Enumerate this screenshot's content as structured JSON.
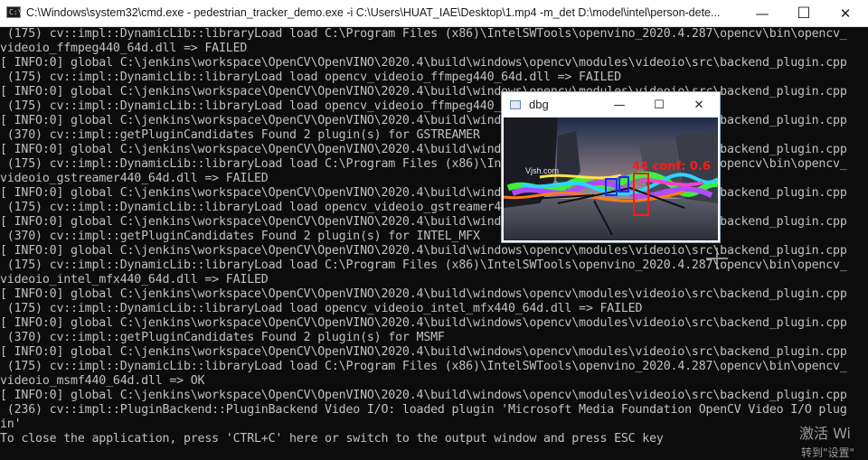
{
  "window": {
    "title": "C:\\Windows\\system32\\cmd.exe - pedestrian_tracker_demo.exe  -i C:\\Users\\HUAT_IAE\\Desktop\\1.mp4 -m_det D:\\model\\intel\\person-dete...",
    "icon_text": "C:\\",
    "minimize_glyph": "—",
    "maximize_glyph": "☐",
    "close_glyph": "✕"
  },
  "console": {
    "lines": [
      " (175) cv::impl::DynamicLib::libraryLoad load C:\\Program Files (x86)\\IntelSWTools\\openvino_2020.4.287\\opencv\\bin\\opencv_",
      "videoio_ffmpeg440_64d.dll => FAILED",
      "[ INFO:0] global C:\\jenkins\\workspace\\OpenCV\\OpenVINO\\2020.4\\build\\windows\\opencv\\modules\\videoio\\src\\backend_plugin.cpp",
      " (175) cv::impl::DynamicLib::libraryLoad load opencv_videoio_ffmpeg440_64d.dll => FAILED",
      "[ INFO:0] global C:\\jenkins\\workspace\\OpenCV\\OpenVINO\\2020.4\\build\\windows\\opencv\\modules\\videoio\\src\\backend_plugin.cpp",
      " (175) cv::impl::DynamicLib::libraryLoad load opencv_videoio_ffmpeg440_64d.dll => FAILED",
      "[ INFO:0] global C:\\jenkins\\workspace\\OpenCV\\OpenVINO\\2020.4\\build\\windows\\opencv\\modules\\videoio\\src\\backend_plugin.cpp",
      " (370) cv::impl::getPluginCandidates Found 2 plugin(s) for GSTREAMER",
      "[ INFO:0] global C:\\jenkins\\workspace\\OpenCV\\OpenVINO\\2020.4\\build\\windows\\opencv\\modules\\videoio\\src\\backend_plugin.cpp",
      " (175) cv::impl::DynamicLib::libraryLoad load C:\\Program Files (x86)\\IntelSWTools\\openvino_2020.4.287\\opencv\\bin\\opencv_",
      "videoio_gstreamer440_64d.dll => FAILED",
      "[ INFO:0] global C:\\jenkins\\workspace\\OpenCV\\OpenVINO\\2020.4\\build\\windows\\opencv\\modules\\videoio\\src\\backend_plugin.cpp",
      " (175) cv::impl::DynamicLib::libraryLoad load opencv_videoio_gstreamer440_64d.dll => FAILED",
      "[ INFO:0] global C:\\jenkins\\workspace\\OpenCV\\OpenVINO\\2020.4\\build\\windows\\opencv\\modules\\videoio\\src\\backend_plugin.cpp",
      " (370) cv::impl::getPluginCandidates Found 2 plugin(s) for INTEL_MFX",
      "[ INFO:0] global C:\\jenkins\\workspace\\OpenCV\\OpenVINO\\2020.4\\build\\windows\\opencv\\modules\\videoio\\src\\backend_plugin.cpp",
      " (175) cv::impl::DynamicLib::libraryLoad load C:\\Program Files (x86)\\IntelSWTools\\openvino_2020.4.287\\opencv\\bin\\opencv_",
      "videoio_intel_mfx440_64d.dll => FAILED",
      "[ INFO:0] global C:\\jenkins\\workspace\\OpenCV\\OpenVINO\\2020.4\\build\\windows\\opencv\\modules\\videoio\\src\\backend_plugin.cpp",
      " (175) cv::impl::DynamicLib::libraryLoad load opencv_videoio_intel_mfx440_64d.dll => FAILED",
      "[ INFO:0] global C:\\jenkins\\workspace\\OpenCV\\OpenVINO\\2020.4\\build\\windows\\opencv\\modules\\videoio\\src\\backend_plugin.cpp",
      " (370) cv::impl::getPluginCandidates Found 2 plugin(s) for MSMF",
      "[ INFO:0] global C:\\jenkins\\workspace\\OpenCV\\OpenVINO\\2020.4\\build\\windows\\opencv\\modules\\videoio\\src\\backend_plugin.cpp",
      " (175) cv::impl::DynamicLib::libraryLoad load C:\\Program Files (x86)\\IntelSWTools\\openvino_2020.4.287\\opencv\\bin\\opencv_",
      "videoio_msmf440_64d.dll => OK",
      "[ INFO:0] global C:\\jenkins\\workspace\\OpenCV\\OpenVINO\\2020.4\\build\\windows\\opencv\\modules\\videoio\\src\\backend_plugin.cpp",
      " (236) cv::impl::PluginBackend::PluginBackend Video I/O: loaded plugin 'Microsoft Media Foundation OpenCV Video I/O plug",
      "in'",
      "To close the application, press 'CTRL+C' here or switch to the output window and press ESC key"
    ]
  },
  "dbg_window": {
    "title": "dbg",
    "minimize_glyph": "—",
    "maximize_glyph": "☐",
    "close_glyph": "✕",
    "overlay_text": "44  conf: 0.6",
    "watermark_text": "Vjsh.com"
  },
  "watermark": {
    "line1": "激活 Wi",
    "line2": "转到\"设置\""
  },
  "colors": {
    "console_bg": "#0c0c0c",
    "console_text": "#c0c0c0",
    "bbox_red": "#ff1a1a",
    "bbox_blue": "#1a2cff"
  }
}
